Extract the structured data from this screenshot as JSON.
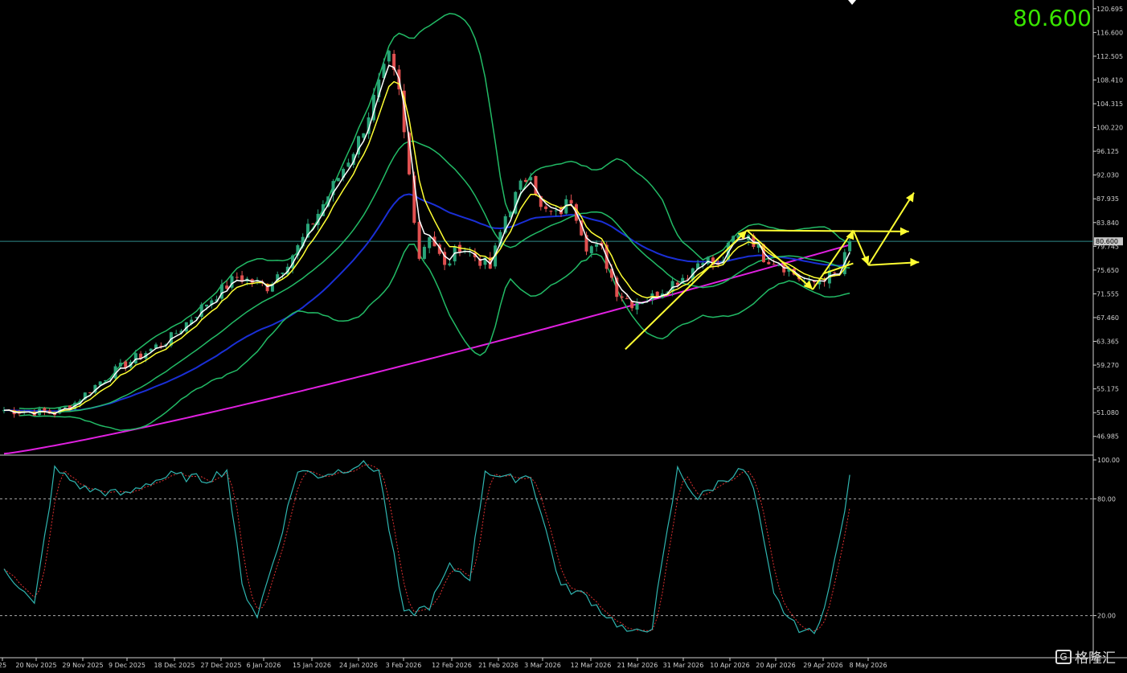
{
  "chart_data": [
    {
      "type": "candlestick",
      "pane": "price",
      "instrument_price_label": "80.600",
      "current_price": 80.6,
      "ylim": [
        43.9,
        121.5
      ],
      "y_ticks": [
        "120.695",
        "116.600",
        "112.505",
        "108.410",
        "104.315",
        "100.220",
        "96.125",
        "92.030",
        "87.935",
        "83.840",
        "79.745",
        "75.650",
        "71.555",
        "67.460",
        "63.365",
        "59.270",
        "55.175",
        "51.080",
        "46.985"
      ],
      "x_ticks": [
        "25",
        "20 Nov 2025",
        "29 Nov 2025",
        "9 Dec 2025",
        "18 Dec 2025",
        "27 Dec 2025",
        "6 Jan 2026",
        "15 Jan 2026",
        "24 Jan 2026",
        "3 Feb 2026",
        "12 Feb 2026",
        "21 Feb 2026",
        "3 Mar 2026",
        "12 Mar 2026",
        "21 Mar 2026",
        "31 Mar 2026",
        "10 Apr 2026",
        "20 Apr 2026",
        "29 Apr 2026",
        "8 May 2026"
      ],
      "close_keypoints": [
        [
          0,
          51.5
        ],
        [
          10,
          51.0
        ],
        [
          14,
          52.8
        ],
        [
          20,
          57.2
        ],
        [
          26,
          60.5
        ],
        [
          33,
          64.0
        ],
        [
          40,
          70.0
        ],
        [
          46,
          74.5
        ],
        [
          52,
          72.8
        ],
        [
          58,
          79.5
        ],
        [
          64,
          88.5
        ],
        [
          70,
          98.0
        ],
        [
          76,
          112.0
        ],
        [
          78,
          106.0
        ],
        [
          80,
          92.0
        ],
        [
          82,
          78.0
        ],
        [
          84,
          82.0
        ],
        [
          87,
          76.0
        ],
        [
          90,
          80.0
        ],
        [
          93,
          78.0
        ],
        [
          96,
          76.0
        ],
        [
          99,
          85.0
        ],
        [
          102,
          90.0
        ],
        [
          104,
          93.0
        ],
        [
          106,
          86.0
        ],
        [
          109,
          85.0
        ],
        [
          112,
          88.0
        ],
        [
          115,
          80.0
        ],
        [
          118,
          79.0
        ],
        [
          121,
          72.0
        ],
        [
          124,
          70.0
        ],
        [
          128,
          71.0
        ],
        [
          131,
          73.0
        ],
        [
          135,
          75.0
        ],
        [
          138,
          78.0
        ],
        [
          141,
          76.0
        ],
        [
          144,
          81.0
        ],
        [
          147,
          82.0
        ],
        [
          150,
          78.0
        ],
        [
          153,
          77.0
        ],
        [
          156,
          75.0
        ],
        [
          159,
          73.0
        ],
        [
          162,
          74.5
        ],
        [
          165,
          75.0
        ],
        [
          167,
          80.6
        ]
      ],
      "series": [
        {
          "name": "",
          "color": "#ffffff",
          "kind": "ema_fast"
        },
        {
          "name": "",
          "color": "#ffff33",
          "kind": "ema_mid"
        },
        {
          "name": "",
          "color": "#22bb66",
          "kind": "bollinger"
        },
        {
          "name": "",
          "color": "#1a2fd6",
          "kind": "ema_slow"
        },
        {
          "name": "",
          "color": "#e020e0",
          "kind": "ema_long"
        }
      ],
      "colors": {
        "bull": "#2aa57a",
        "bear": "#e05050",
        "wick": "#bbbbbb"
      }
    },
    {
      "type": "line",
      "pane": "oscillator",
      "ylim": [
        0,
        100
      ],
      "y_ticks": [
        "100.00",
        "80.00",
        "20.00"
      ],
      "levels": [
        80,
        20
      ],
      "main_keypoints": [
        [
          0,
          45
        ],
        [
          6,
          25
        ],
        [
          10,
          95
        ],
        [
          16,
          85
        ],
        [
          24,
          82
        ],
        [
          28,
          88
        ],
        [
          33,
          92
        ],
        [
          40,
          90
        ],
        [
          44,
          95
        ],
        [
          47,
          35
        ],
        [
          50,
          20
        ],
        [
          54,
          55
        ],
        [
          58,
          95
        ],
        [
          62,
          92
        ],
        [
          67,
          95
        ],
        [
          70,
          98
        ],
        [
          74,
          95
        ],
        [
          79,
          20
        ],
        [
          84,
          25
        ],
        [
          88,
          45
        ],
        [
          92,
          40
        ],
        [
          95,
          95
        ],
        [
          99,
          90
        ],
        [
          104,
          92
        ],
        [
          110,
          35
        ],
        [
          115,
          30
        ],
        [
          119,
          20
        ],
        [
          124,
          10
        ],
        [
          128,
          15
        ],
        [
          133,
          95
        ],
        [
          137,
          80
        ],
        [
          142,
          90
        ],
        [
          146,
          95
        ],
        [
          148,
          85
        ],
        [
          152,
          30
        ],
        [
          156,
          15
        ],
        [
          160,
          10
        ],
        [
          163,
          35
        ],
        [
          165,
          60
        ],
        [
          167,
          90
        ]
      ],
      "colors": {
        "main": "#2fb5b0",
        "signal": "#e03030"
      }
    }
  ],
  "watermark": {
    "box": "G",
    "text": "格隆汇"
  }
}
